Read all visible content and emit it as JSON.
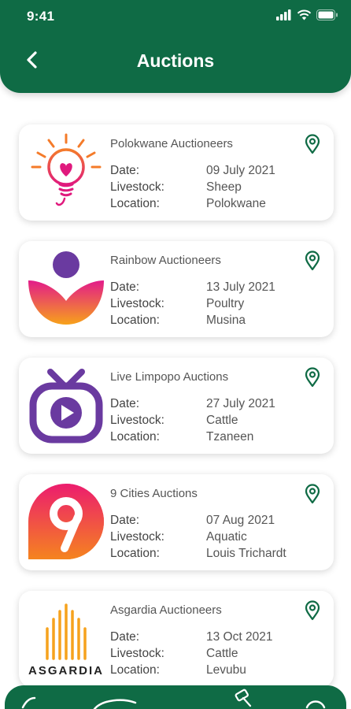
{
  "status_bar": {
    "time": "9:41"
  },
  "header": {
    "title": "Auctions"
  },
  "labels": {
    "date": "Date:",
    "livestock": "Livestock:",
    "location": "Location:"
  },
  "auctions": [
    {
      "name": "Polokwane Auctioneers",
      "date": "09 July 2021",
      "livestock": "Sheep",
      "location": "Polokwane",
      "logo": "lightbulb-heart-logo"
    },
    {
      "name": "Rainbow Auctioneers",
      "date": "13 July 2021",
      "livestock": "Poultry",
      "location": "Musina",
      "logo": "rainbow-person-logo"
    },
    {
      "name": "Live Limpopo Auctions",
      "date": "27 July 2021",
      "livestock": "Cattle",
      "location": "Tzaneen",
      "logo": "tv-play-logo"
    },
    {
      "name": "9 Cities Auctions",
      "date": "07 Aug 2021",
      "livestock": "Aquatic",
      "location": "Louis Trichardt",
      "logo": "nine-logo"
    },
    {
      "name": "Asgardia Auctioneers",
      "date": "13 Oct 2021",
      "livestock": "Cattle",
      "location": "Levubu",
      "logo": "asgardia-logo",
      "logo_text": "ASGARDIA"
    }
  ],
  "colors": {
    "primary": "#0f6b45",
    "pin": "#0f6b45"
  }
}
